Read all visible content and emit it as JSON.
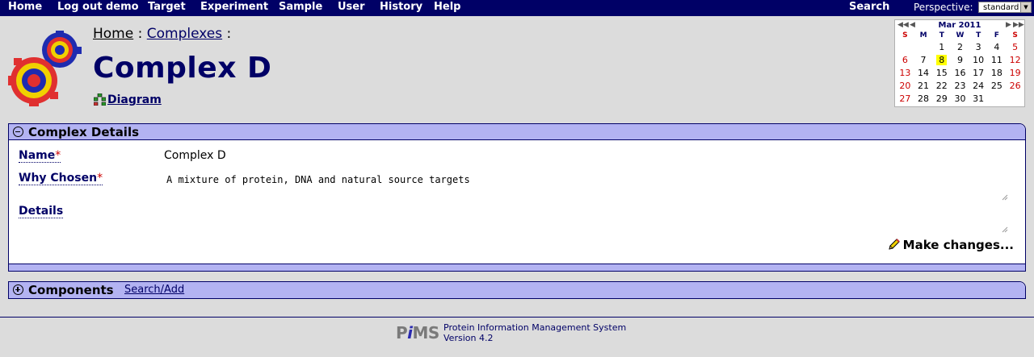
{
  "nav": {
    "items": [
      "Home",
      "Log out demo",
      "Target",
      "Experiment",
      "Sample",
      "User",
      "History",
      "Help"
    ],
    "search": "Search",
    "perspective_label": "Perspective:",
    "perspective_value": "standard"
  },
  "breadcrumb": {
    "home": "Home",
    "sep1": ":",
    "complexes": "Complexes",
    "sep2": ":"
  },
  "page": {
    "title": "Complex D",
    "diagram_link": "Diagram"
  },
  "calendar": {
    "month": "Mar 2011",
    "weekdays": [
      "S",
      "M",
      "T",
      "W",
      "T",
      "F",
      "S"
    ],
    "weeks": [
      [
        "",
        "",
        "1",
        "2",
        "3",
        "4",
        "5"
      ],
      [
        "6",
        "7",
        "8",
        "9",
        "10",
        "11",
        "12"
      ],
      [
        "13",
        "14",
        "15",
        "16",
        "17",
        "18",
        "19"
      ],
      [
        "20",
        "21",
        "22",
        "23",
        "24",
        "25",
        "26"
      ],
      [
        "27",
        "28",
        "29",
        "30",
        "31",
        "",
        ""
      ]
    ],
    "today": "8"
  },
  "details": {
    "header": "Complex Details",
    "name_label": "Name",
    "name_value": "Complex D",
    "why_label": "Why Chosen",
    "why_value": "A mixture of protein, DNA and natural source targets",
    "details_label": "Details",
    "details_value": "",
    "required_mark": "*",
    "make_changes": "Make changes..."
  },
  "components": {
    "header": "Components",
    "search_add": "Search/Add"
  },
  "footer": {
    "logo_p": "P",
    "logo_i": "i",
    "logo_ms": "MS",
    "line1": "Protein Information Management System",
    "line2": "Version 4.2"
  },
  "colors": {
    "nav_bg": "#000066",
    "panel_header": "#b3b3f2",
    "title": "#000066",
    "required": "#cc0000",
    "today_highlight": "#ffff00"
  }
}
